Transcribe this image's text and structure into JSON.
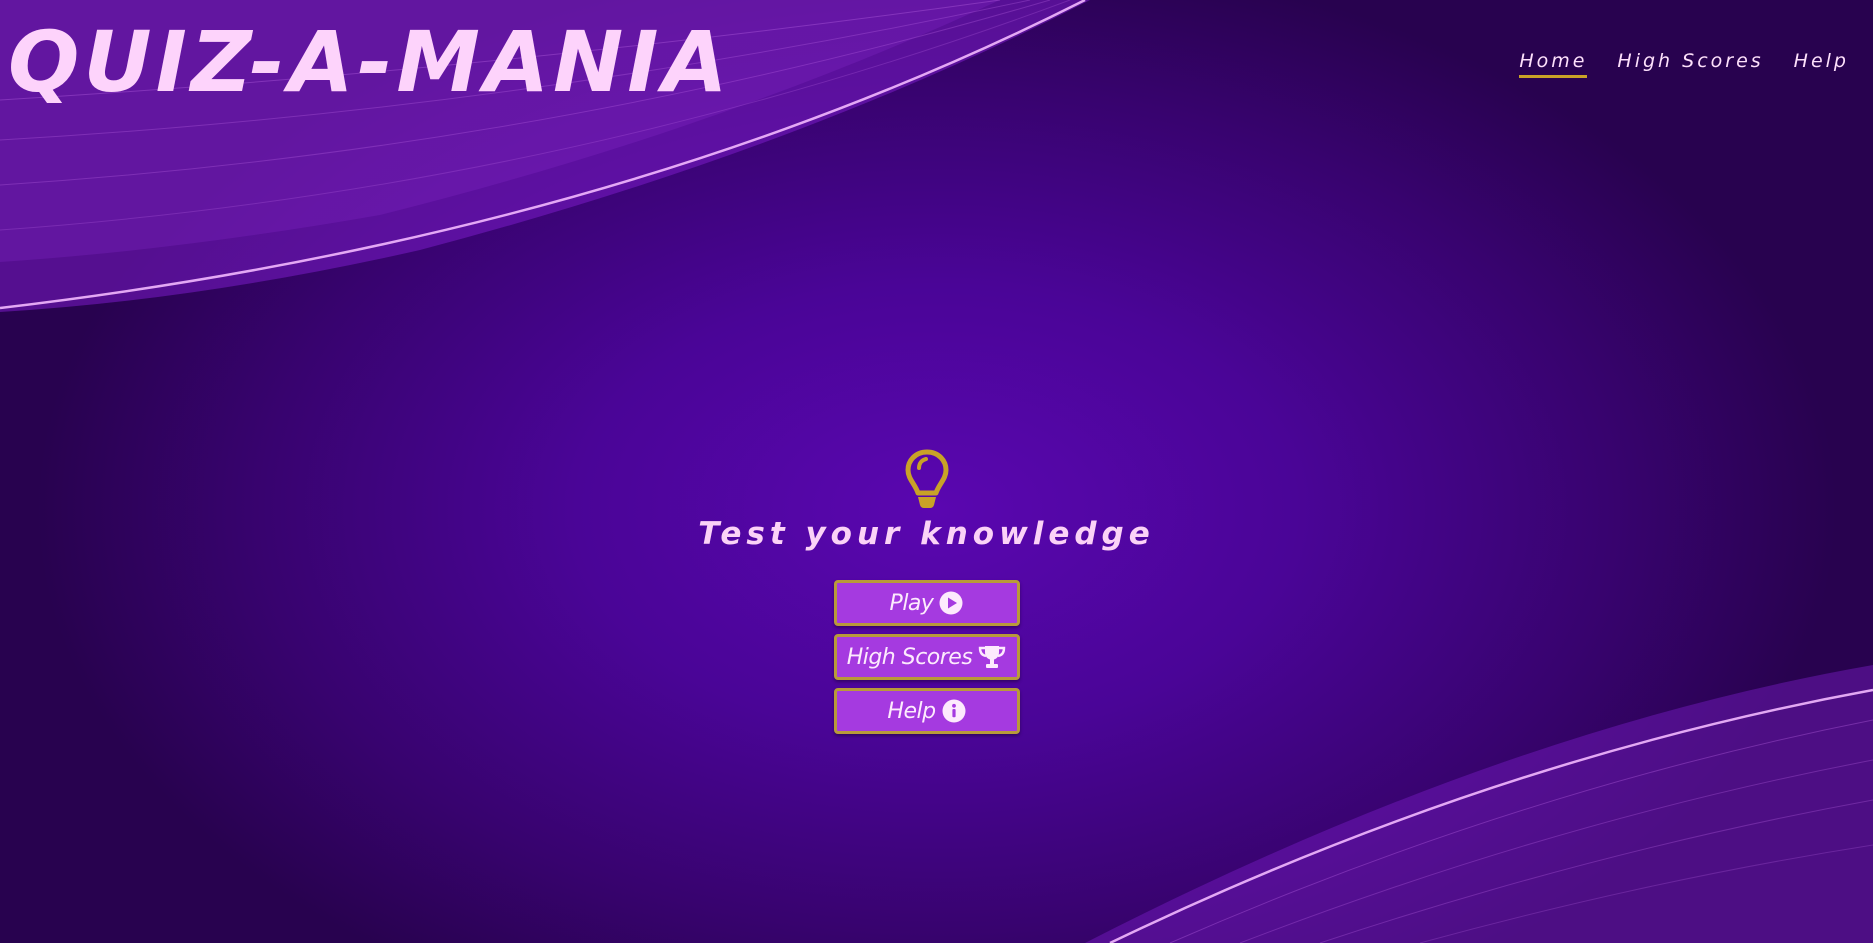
{
  "app": {
    "title": "QUIZ-A-MANIA"
  },
  "nav": {
    "items": [
      {
        "label": "Home",
        "active": true
      },
      {
        "label": "High Scores",
        "active": false
      },
      {
        "label": "Help",
        "active": false
      }
    ]
  },
  "main": {
    "icon": "lightbulb-icon",
    "tagline": "Test your knowledge",
    "buttons": [
      {
        "label": "Play",
        "icon": "play-circle-icon"
      },
      {
        "label": "High Scores",
        "icon": "trophy-icon"
      },
      {
        "label": "Help",
        "icon": "info-circle-icon"
      }
    ]
  },
  "colors": {
    "background": "#4a0597",
    "logo_text": "#fdd3fb",
    "accent_gold": "#c9a227",
    "button_fill": "#a53ae0",
    "button_border": "#b99a3a"
  }
}
